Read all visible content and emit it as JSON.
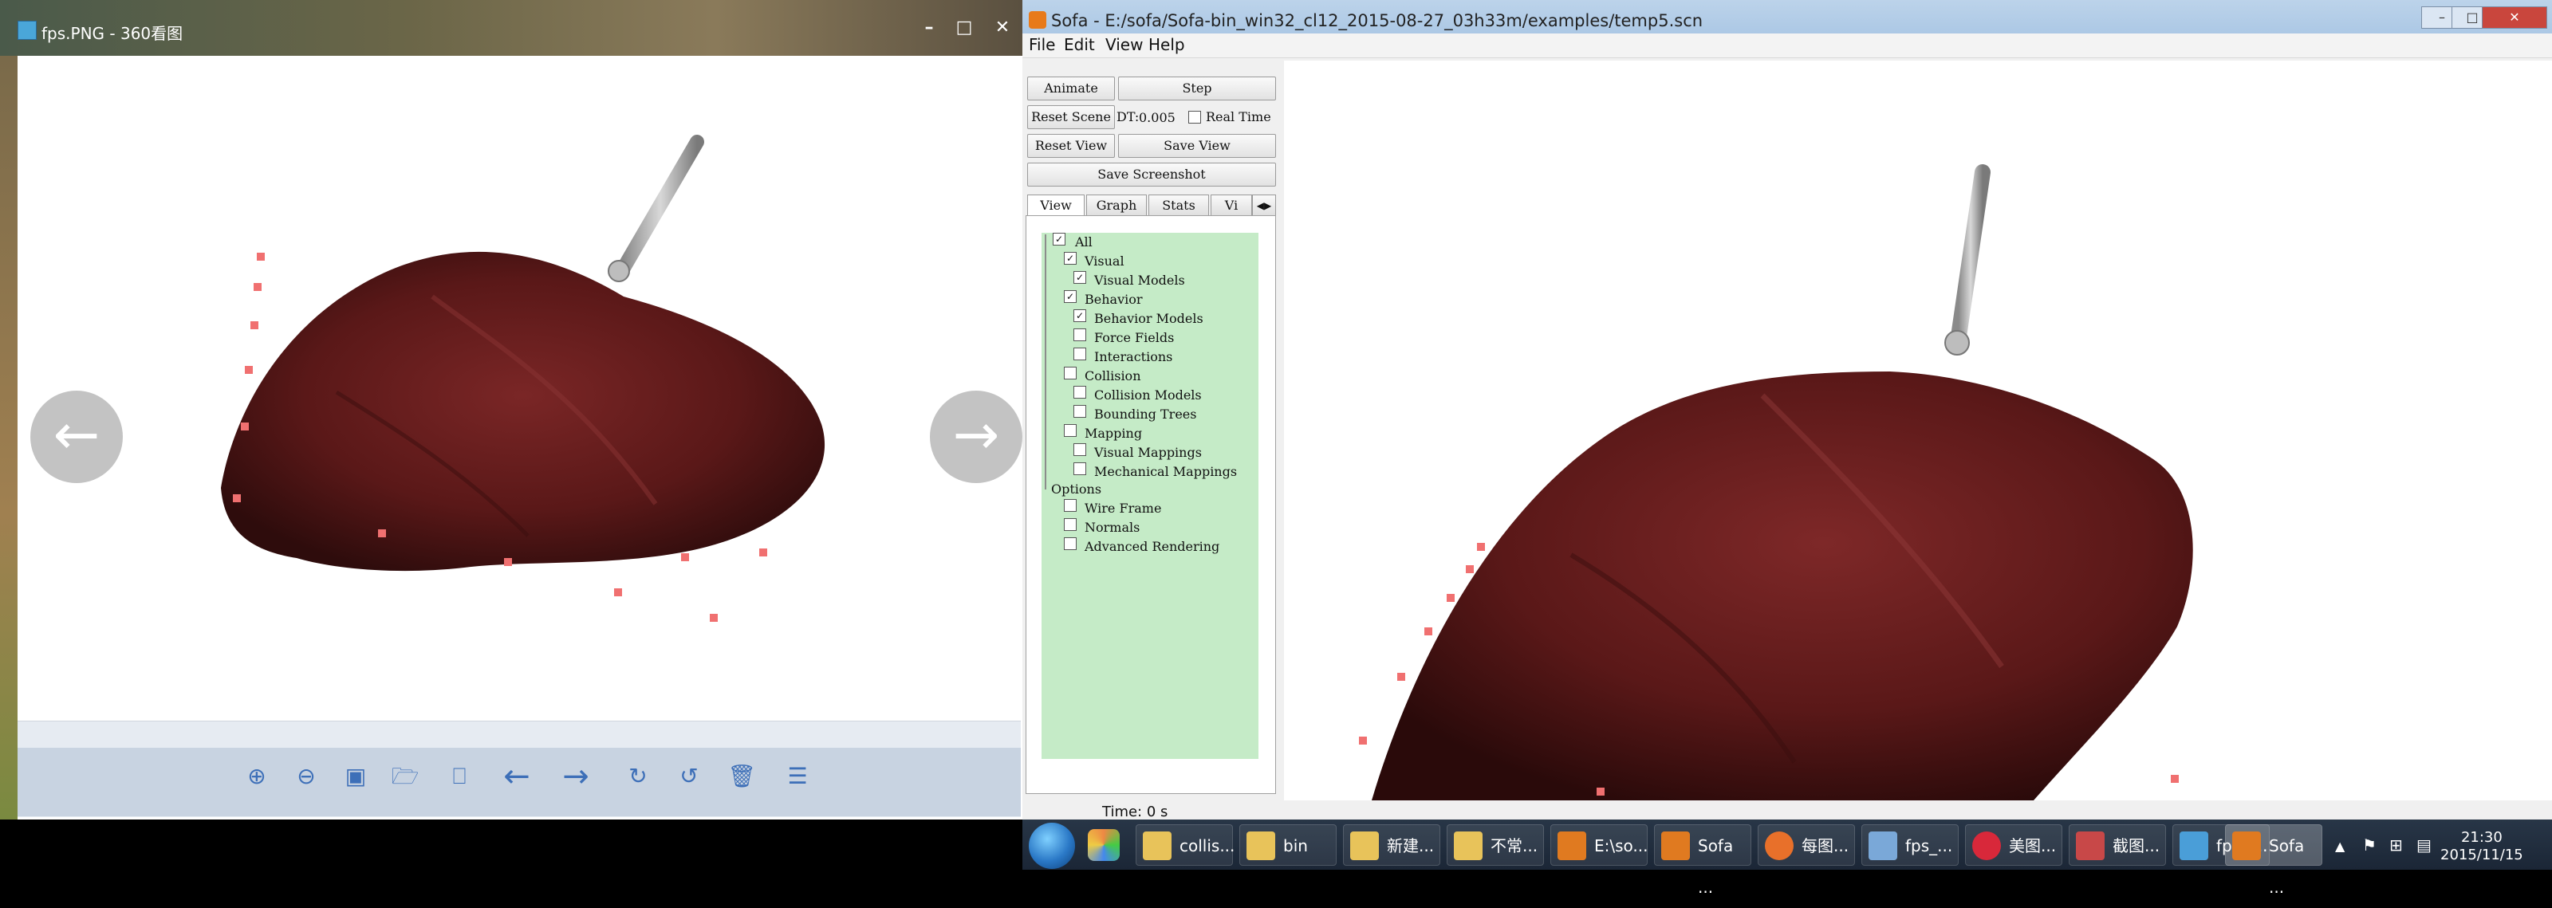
{
  "viewer": {
    "title": "fps.PNG - 360看图",
    "min_icon": "minimize-icon",
    "max_icon": "maximize-icon",
    "close_icon": "close-icon",
    "tools": [
      "zoom-in-icon",
      "zoom-out-icon",
      "fit-icon",
      "folder-icon",
      "slideshow-icon",
      "prev-arrow-icon",
      "next-arrow-icon",
      "rotate-right-icon",
      "rotate-left-icon",
      "delete-icon",
      "menu-icon"
    ]
  },
  "sofa": {
    "title": "Sofa - E:/sofa/Sofa-bin_win32_cl12_2015-08-27_03h33m/examples/temp5.scn",
    "menu": [
      "File",
      "Edit",
      "View",
      "Help"
    ],
    "buttons": {
      "animate": "Animate",
      "step": "Step",
      "reset_scene": "Reset Scene",
      "dt_label": "DT:",
      "dt_value": "0.005",
      "real_time": "Real Time",
      "reset_view": "Reset View",
      "save_view": "Save View",
      "save_screenshot": "Save Screenshot"
    },
    "tabs": [
      "View",
      "Graph",
      "Stats",
      "Vi"
    ],
    "tree": [
      {
        "label": "All",
        "checked": true,
        "level": 0
      },
      {
        "label": "Visual",
        "checked": true,
        "level": 1
      },
      {
        "label": "Visual Models",
        "checked": true,
        "level": 2
      },
      {
        "label": "Behavior",
        "checked": true,
        "level": 1
      },
      {
        "label": "Behavior Models",
        "checked": true,
        "level": 2
      },
      {
        "label": "Force Fields",
        "checked": false,
        "level": 2
      },
      {
        "label": "Interactions",
        "checked": false,
        "level": 2
      },
      {
        "label": "Collision",
        "checked": false,
        "level": 1
      },
      {
        "label": "Collision Models",
        "checked": false,
        "level": 2
      },
      {
        "label": "Bounding Trees",
        "checked": false,
        "level": 2
      },
      {
        "label": "Mapping",
        "checked": false,
        "level": 1
      },
      {
        "label": "Visual Mappings",
        "checked": false,
        "level": 2
      },
      {
        "label": "Mechanical Mappings",
        "checked": false,
        "level": 2
      }
    ],
    "options_label": "Options",
    "options": [
      {
        "label": "Wire Frame",
        "checked": false
      },
      {
        "label": "Normals",
        "checked": false
      },
      {
        "label": "Advanced Rendering",
        "checked": false
      }
    ],
    "status": "Time: 0 s"
  },
  "taskbar": {
    "items": [
      {
        "label": "collis...",
        "icon": "folder-icon"
      },
      {
        "label": "bin",
        "icon": "folder-icon"
      },
      {
        "label": "新建...",
        "icon": "folder-icon"
      },
      {
        "label": "不常...",
        "icon": "folder-icon"
      },
      {
        "label": "E:\\so...",
        "icon": "sofa-icon"
      },
      {
        "label": "Sofa ...",
        "icon": "sofa-icon"
      },
      {
        "label": "每图...",
        "icon": "firefox-icon"
      },
      {
        "label": "fps_...",
        "icon": "paint-icon"
      },
      {
        "label": "美图...",
        "icon": "meitu-icon"
      },
      {
        "label": "截图...",
        "icon": "snip-icon"
      },
      {
        "label": "fps.P...",
        "icon": "image-icon"
      },
      {
        "label": "Sofa ...",
        "icon": "sofa-icon"
      }
    ],
    "clock_time": "21:30",
    "clock_date": "2015/11/15"
  },
  "colors": {
    "tree_bg": "#c5ebc7",
    "organ": "#5a1616",
    "marker": "#f07070",
    "instrument": "#b8b8b8"
  }
}
